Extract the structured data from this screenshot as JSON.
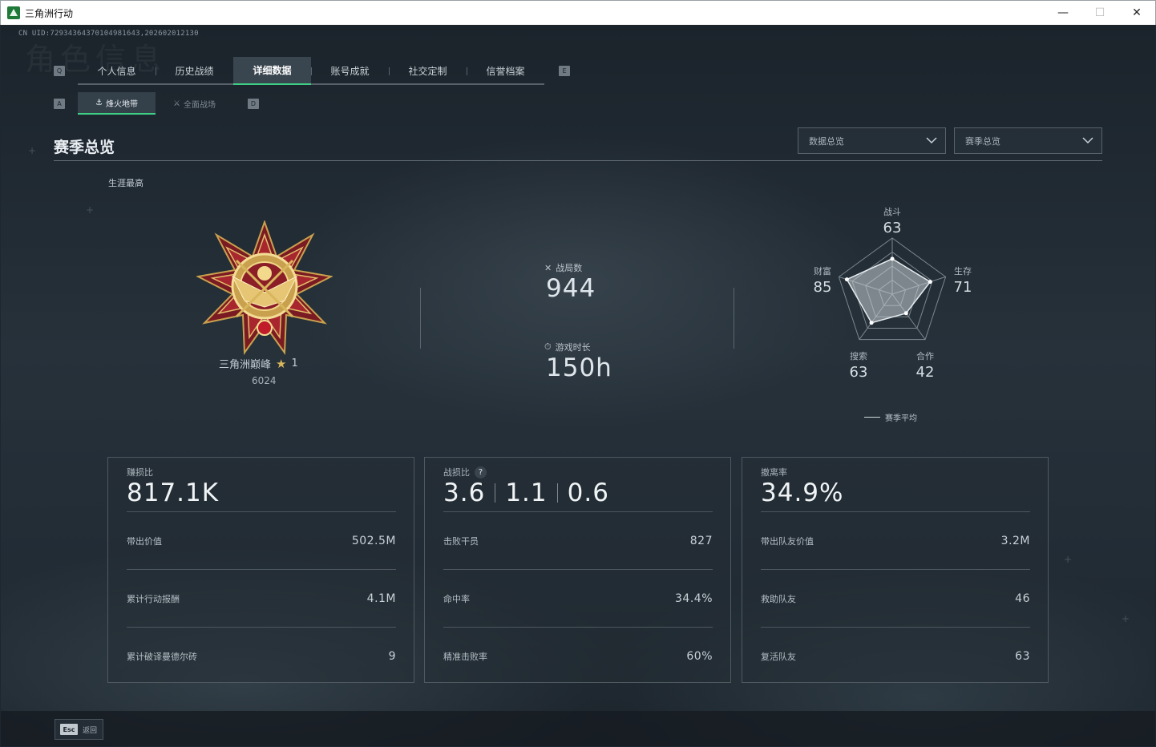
{
  "window": {
    "title": "三角洲行动",
    "minimize": "—",
    "maximize": "☐",
    "close": "✕"
  },
  "uid": "CN UID:7293436437010498164​3,202602012130",
  "watermark": "角色信息",
  "key_hints": {
    "prev_tab": "Q",
    "next_tab": "E",
    "prev_sub": "A",
    "next_sub": "D"
  },
  "tabs": [
    {
      "label": "个人信息"
    },
    {
      "label": "历史战绩"
    },
    {
      "label": "详细数据",
      "active": true
    },
    {
      "label": "账号成就"
    },
    {
      "label": "社交定制"
    },
    {
      "label": "信誉档案"
    }
  ],
  "subtabs": [
    {
      "label": "烽火地带",
      "icon": "beacon-icon",
      "active": true
    },
    {
      "label": "全面战场",
      "icon": "battlefield-icon"
    }
  ],
  "section": {
    "title": "赛季总览"
  },
  "dropdowns": {
    "data": "数据总览",
    "season": "赛季总览"
  },
  "career": {
    "label": "生涯最高",
    "rank_name": "三角洲巅峰",
    "rank_stars": "1",
    "rank_score": "6024"
  },
  "matches": {
    "label": "战局数",
    "value": "944"
  },
  "playtime": {
    "label": "游戏时长",
    "value": "150h"
  },
  "radar": {
    "axes": [
      {
        "name": "战斗",
        "value": "63"
      },
      {
        "name": "生存",
        "value": "71"
      },
      {
        "name": "合作",
        "value": "42"
      },
      {
        "name": "搜索",
        "value": "63"
      },
      {
        "name": "财富",
        "value": "85"
      }
    ],
    "legend": "赛季平均"
  },
  "cards": [
    {
      "label": "赚损比",
      "big": "817.1K",
      "rows": [
        {
          "k": "带出价值",
          "v": "502.5M"
        },
        {
          "k": "累计行动报酬",
          "v": "4.1M"
        },
        {
          "k": "累计破译曼德尔砖",
          "v": "9"
        }
      ]
    },
    {
      "label": "战损比",
      "help": "?",
      "big_parts": [
        "3.6",
        "1.1",
        "0.6"
      ],
      "rows": [
        {
          "k": "击败干员",
          "v": "827"
        },
        {
          "k": "命中率",
          "v": "34.4%"
        },
        {
          "k": "精准击败率",
          "v": "60%"
        }
      ]
    },
    {
      "label": "撤离率",
      "big": "34.9%",
      "rows": [
        {
          "k": "带出队友价值",
          "v": "3.2M"
        },
        {
          "k": "救助队友",
          "v": "46"
        },
        {
          "k": "复活队友",
          "v": "63"
        }
      ]
    }
  ],
  "footer": {
    "esc_key": "Esc",
    "back_label": "返回"
  },
  "colors": {
    "accent": "#3fcf84",
    "background": "#1e2730",
    "gold": "#d8b65c",
    "crimson": "#8e1f28"
  }
}
